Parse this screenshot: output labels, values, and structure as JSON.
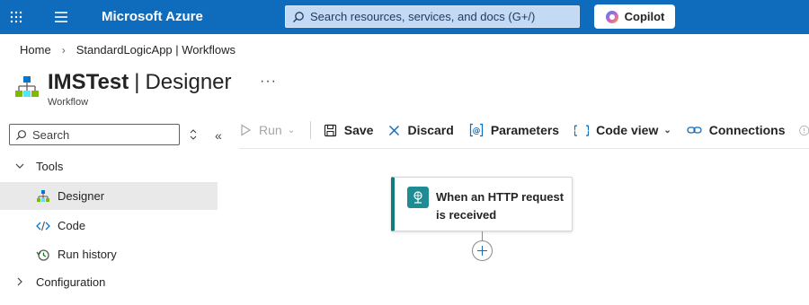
{
  "topbar": {
    "brand": "Microsoft Azure",
    "search_placeholder": "Search resources, services, and docs (G+/)",
    "copilot_label": "Copilot"
  },
  "breadcrumb": {
    "home": "Home",
    "parent": "StandardLogicApp | Workflows"
  },
  "header": {
    "resource_name": "IMSTest",
    "section": "Designer",
    "subtitle": "Workflow",
    "more": "···"
  },
  "sidebar": {
    "search_placeholder": "Search",
    "collapse_glyph": "«",
    "groups": [
      {
        "label": "Tools",
        "expanded": true,
        "items": [
          {
            "label": "Designer",
            "icon": "designer-icon",
            "active": true
          },
          {
            "label": "Code",
            "icon": "code-icon",
            "active": false
          },
          {
            "label": "Run history",
            "icon": "run-history-icon",
            "active": false
          }
        ]
      },
      {
        "label": "Configuration",
        "expanded": false
      }
    ]
  },
  "toolbar": {
    "run_label": "Run",
    "save_label": "Save",
    "discard_label": "Discard",
    "parameters_label": "Parameters",
    "code_view_label": "Code view",
    "connections_label": "Connections"
  },
  "designer": {
    "trigger_title": "When an HTTP request is received"
  },
  "colors": {
    "topbar": "#0f6cbd",
    "trigger_accent": "#107c7c",
    "active_nav": "#e9e9e9"
  }
}
